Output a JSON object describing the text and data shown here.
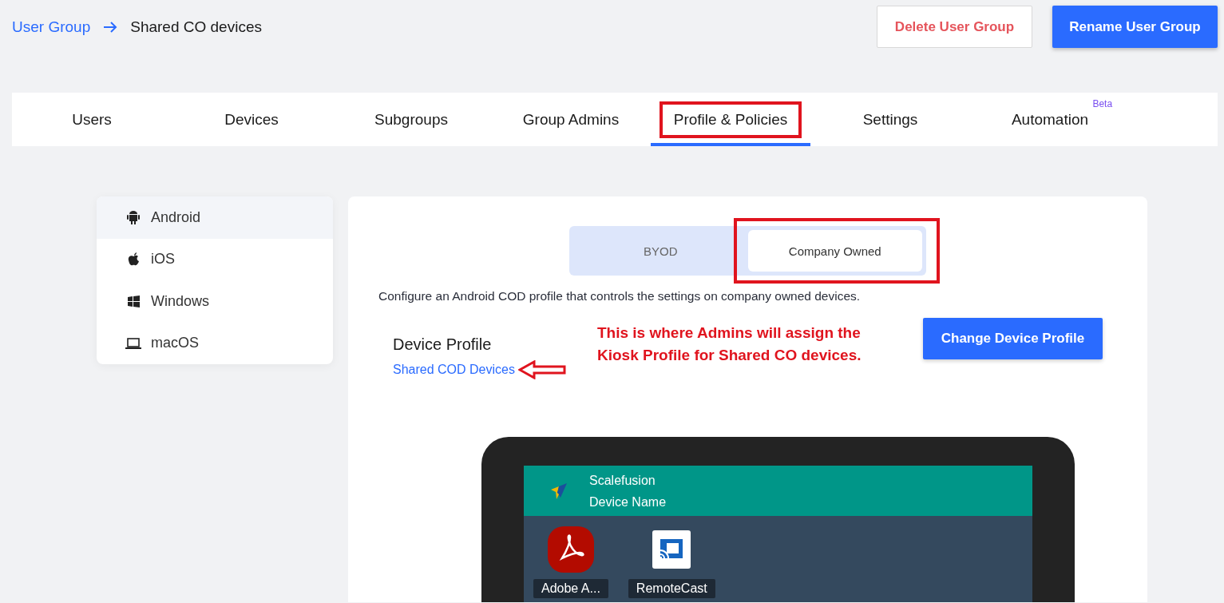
{
  "breadcrumb": {
    "parent": "User Group",
    "current": "Shared CO devices"
  },
  "header_buttons": [
    {
      "label": "Delete User Group",
      "kind": "outline"
    },
    {
      "label": "Rename User Group",
      "kind": "primary"
    }
  ],
  "tabs": [
    {
      "label": "Users",
      "selected": false,
      "annotated": false
    },
    {
      "label": "Devices",
      "selected": false,
      "annotated": false
    },
    {
      "label": "Subgroups",
      "selected": false,
      "annotated": false
    },
    {
      "label": "Group Admins",
      "selected": false,
      "annotated": false
    },
    {
      "label": "Profile & Policies",
      "selected": true,
      "annotated": true
    },
    {
      "label": "Settings",
      "selected": false,
      "annotated": false
    },
    {
      "label": "Automation",
      "selected": false,
      "annotated": false,
      "badge": "Beta"
    }
  ],
  "sidebar": {
    "items": [
      {
        "label": "Android",
        "kind": "android",
        "selected": true
      },
      {
        "label": "iOS",
        "kind": "apple",
        "selected": false
      },
      {
        "label": "Windows",
        "kind": "windows",
        "selected": false
      },
      {
        "label": "macOS",
        "kind": "laptop",
        "selected": false
      }
    ]
  },
  "segments": [
    {
      "label": "BYOD",
      "selected": false,
      "annotated": false
    },
    {
      "label": "Company Owned",
      "selected": true,
      "annotated": true
    }
  ],
  "description": "Configure an Android COD profile that controls the settings on company owned devices.",
  "device_profile": {
    "heading": "Device Profile",
    "link": "Shared COD Devices"
  },
  "annotation": "This is where Admins will assign the Kiosk Profile for Shared CO devices.",
  "change_button": "Change Device Profile",
  "preview": {
    "title": "Scalefusion",
    "subtitle": "Device Name",
    "apps": [
      {
        "label": "Adobe A...",
        "kind": "pdf"
      },
      {
        "label": "RemoteCast",
        "kind": "cast"
      }
    ]
  }
}
